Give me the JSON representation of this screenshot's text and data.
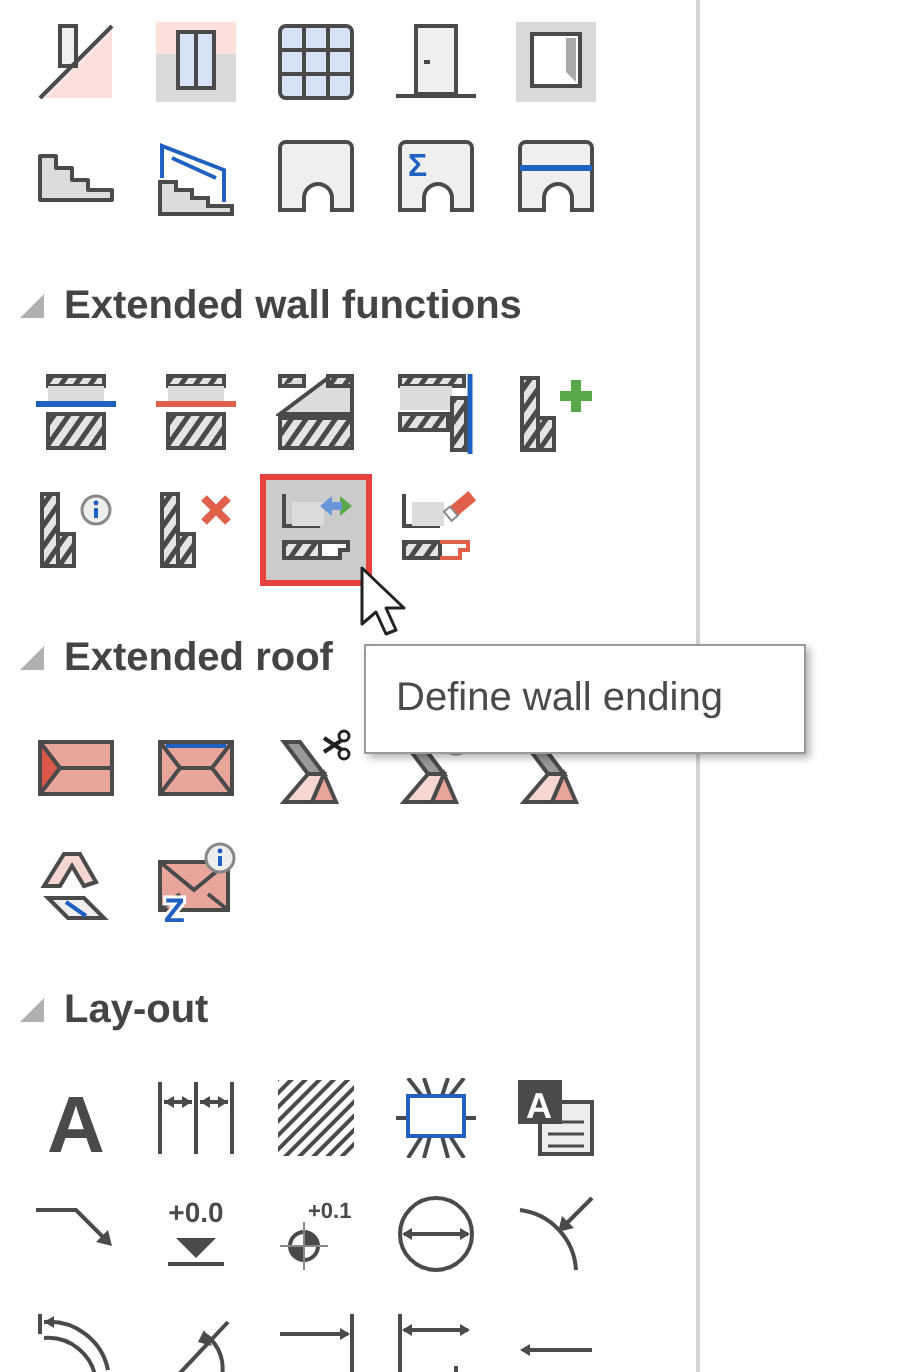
{
  "groups": [
    {
      "tools": [
        {
          "kind": "wall-slope",
          "selected": false
        },
        {
          "kind": "window-panel",
          "selected": false
        },
        {
          "kind": "grid-window",
          "selected": false
        },
        {
          "kind": "door",
          "selected": false
        },
        {
          "kind": "niche-box",
          "selected": false
        },
        {
          "kind": "stairs",
          "selected": false
        },
        {
          "kind": "stairs-railing",
          "selected": false
        },
        {
          "kind": "arch-opening",
          "selected": false
        },
        {
          "kind": "arch-sum",
          "label": "Σ",
          "selected": false
        },
        {
          "kind": "arch-line",
          "selected": false
        }
      ]
    },
    {
      "heading": "Extended wall functions",
      "expanded": true,
      "tools": [
        {
          "kind": "wall-blue-line",
          "selected": false
        },
        {
          "kind": "wall-red-line",
          "selected": false
        },
        {
          "kind": "wall-notch",
          "selected": false
        },
        {
          "kind": "wall-corner-blue",
          "selected": false
        },
        {
          "kind": "wall-add",
          "selected": false
        },
        {
          "kind": "wall-info",
          "selected": false
        },
        {
          "kind": "wall-delete",
          "selected": false
        },
        {
          "kind": "wall-end-arrows",
          "selected": true
        },
        {
          "kind": "wall-end-edit",
          "selected": false
        }
      ]
    },
    {
      "heading": "Extended roof",
      "expanded": true,
      "tools": [
        {
          "kind": "roof-hip",
          "selected": false
        },
        {
          "kind": "roof-blue-ridge",
          "selected": false
        },
        {
          "kind": "roof-cut",
          "selected": false
        },
        {
          "kind": "roof-info",
          "selected": false
        },
        {
          "kind": "roof-ring",
          "selected": false
        },
        {
          "kind": "roof-stack",
          "selected": false
        },
        {
          "kind": "roof-info-z",
          "label": "Z",
          "selected": false
        }
      ]
    },
    {
      "heading": "Lay-out",
      "expanded": true,
      "tools": [
        {
          "kind": "text-big",
          "label": "A",
          "selected": false
        },
        {
          "kind": "dims",
          "selected": false
        },
        {
          "kind": "hatch-area",
          "selected": false
        },
        {
          "kind": "frame-rays",
          "selected": false
        },
        {
          "kind": "text-block",
          "label": "A",
          "selected": false
        },
        {
          "kind": "leader-arrow",
          "selected": false
        },
        {
          "kind": "level-mark",
          "label": "+0.0",
          "selected": false
        },
        {
          "kind": "level-point",
          "label": "+0.1",
          "selected": false
        },
        {
          "kind": "circle-diameter",
          "selected": false
        },
        {
          "kind": "radius-arrow",
          "selected": false
        },
        {
          "kind": "arc-angle",
          "selected": false
        },
        {
          "kind": "angle",
          "selected": false
        },
        {
          "kind": "dim-line-end",
          "selected": false
        },
        {
          "kind": "dim-chain",
          "selected": false
        },
        {
          "kind": "arrow-left",
          "selected": false
        }
      ]
    }
  ],
  "tooltip": {
    "text": "Define wall ending"
  }
}
